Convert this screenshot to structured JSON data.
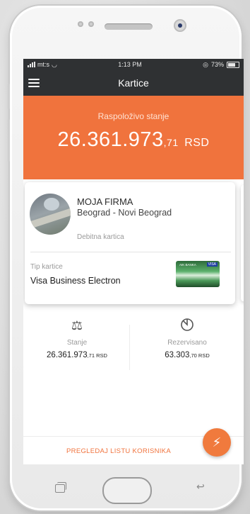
{
  "status": {
    "carrier": "mt:s",
    "time": "1:13 PM",
    "battery": "73%"
  },
  "appbar": {
    "title": "Kartice"
  },
  "balance": {
    "label": "Raspoloživo stanje",
    "amount_main": "26.361.973",
    "amount_decimal": ",71",
    "currency": "RSD"
  },
  "card": {
    "company": "MOJA FIRMA",
    "location": "Beograd - Novi Beograd",
    "card_type": "Debitna kartica",
    "type_label": "Tip kartice",
    "type_value": "Visa Business Electron",
    "card_brand": "VISA",
    "card_bank": "AIK BANKA"
  },
  "stats": [
    {
      "icon": "balance-scale-icon",
      "label": "Stanje",
      "value_main": "26.361.973",
      "value_decimal": ",71 RSD"
    },
    {
      "icon": "pie-chart-icon",
      "label": "Rezervisano",
      "value_main": "63.303",
      "value_decimal": ",70 RSD"
    }
  ],
  "actions": {
    "list_users": "PREGLEDAJ LISTU KORISNIKA",
    "fab_icon": "lightning-icon"
  },
  "colors": {
    "accent": "#f0733d",
    "appbar": "#2f3133"
  }
}
